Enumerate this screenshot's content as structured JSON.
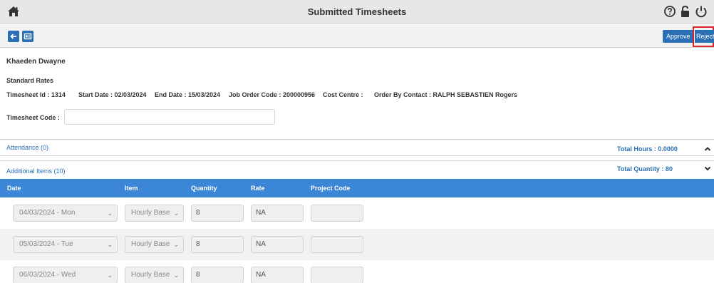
{
  "header": {
    "title": "Submitted Timesheets"
  },
  "toolbar": {
    "approve_label": "Approve",
    "reject_label": "Reject"
  },
  "person": {
    "name": "Khaeden Dwayne",
    "rate_type": "Standard Rates"
  },
  "info": {
    "timesheet_id": "Timesheet Id : 1314",
    "start_date": "Start Date : 02/03/2024",
    "end_date": "End Date : 15/03/2024",
    "job_order": "Job Order Code : 200000956",
    "cost_centre": "Cost Centre :",
    "order_by": "Order By Contact : RALPH SEBASTIEN Rogers"
  },
  "timesheet_code": {
    "label": "Timesheet Code :",
    "value": ""
  },
  "attendance": {
    "label": "Attendance (0)",
    "total": "Total Hours :  0.0000"
  },
  "additional": {
    "label": "Additional Items (10)",
    "total": "Total Quantity :  80"
  },
  "table": {
    "headers": [
      "Date",
      "Item",
      "Quantity",
      "Rate",
      "Project Code"
    ],
    "rows": [
      {
        "date": "04/03/2024 - Mon",
        "item": "Hourly Base",
        "quantity": "8",
        "rate": "NA",
        "project_code": ""
      },
      {
        "date": "05/03/2024 - Tue",
        "item": "Hourly Base",
        "quantity": "8",
        "rate": "NA",
        "project_code": ""
      },
      {
        "date": "06/03/2024 - Wed",
        "item": "Hourly Base",
        "quantity": "8",
        "rate": "NA",
        "project_code": ""
      }
    ]
  },
  "icons": {
    "home": "home-icon",
    "help": "help-circle-icon",
    "lock": "unlock-icon",
    "power": "power-icon",
    "back": "back-arrow-icon",
    "card": "id-card-icon",
    "collapse": "chevron-up-icon",
    "expand": "chevron-down-icon"
  },
  "colors": {
    "primary": "#2a6fb5",
    "table_header": "#3b86d6",
    "highlight": "#d9262c"
  }
}
